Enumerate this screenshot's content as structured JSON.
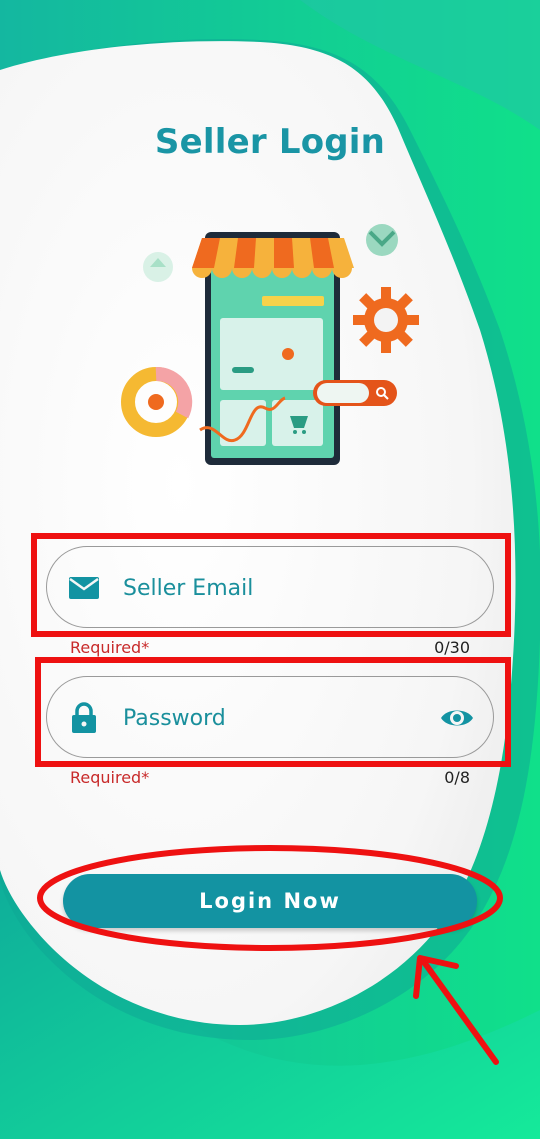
{
  "page": {
    "title": "Seller Login"
  },
  "email_field": {
    "placeholder": "Seller Email",
    "value": "",
    "helper_text": "Required*",
    "counter": "0/30",
    "icon": "mail-icon"
  },
  "password_field": {
    "placeholder": "Password",
    "value": "",
    "helper_text": "Required*",
    "counter": "0/8",
    "icon": "lock-icon",
    "toggle_icon": "eye-icon"
  },
  "login_button": {
    "label": "Login Now"
  },
  "colors": {
    "primary": "#1393a2",
    "title": "#1a95a5",
    "error": "#c82a2a",
    "background_green": "#10c88e",
    "annotation_red": "#ee1111"
  }
}
